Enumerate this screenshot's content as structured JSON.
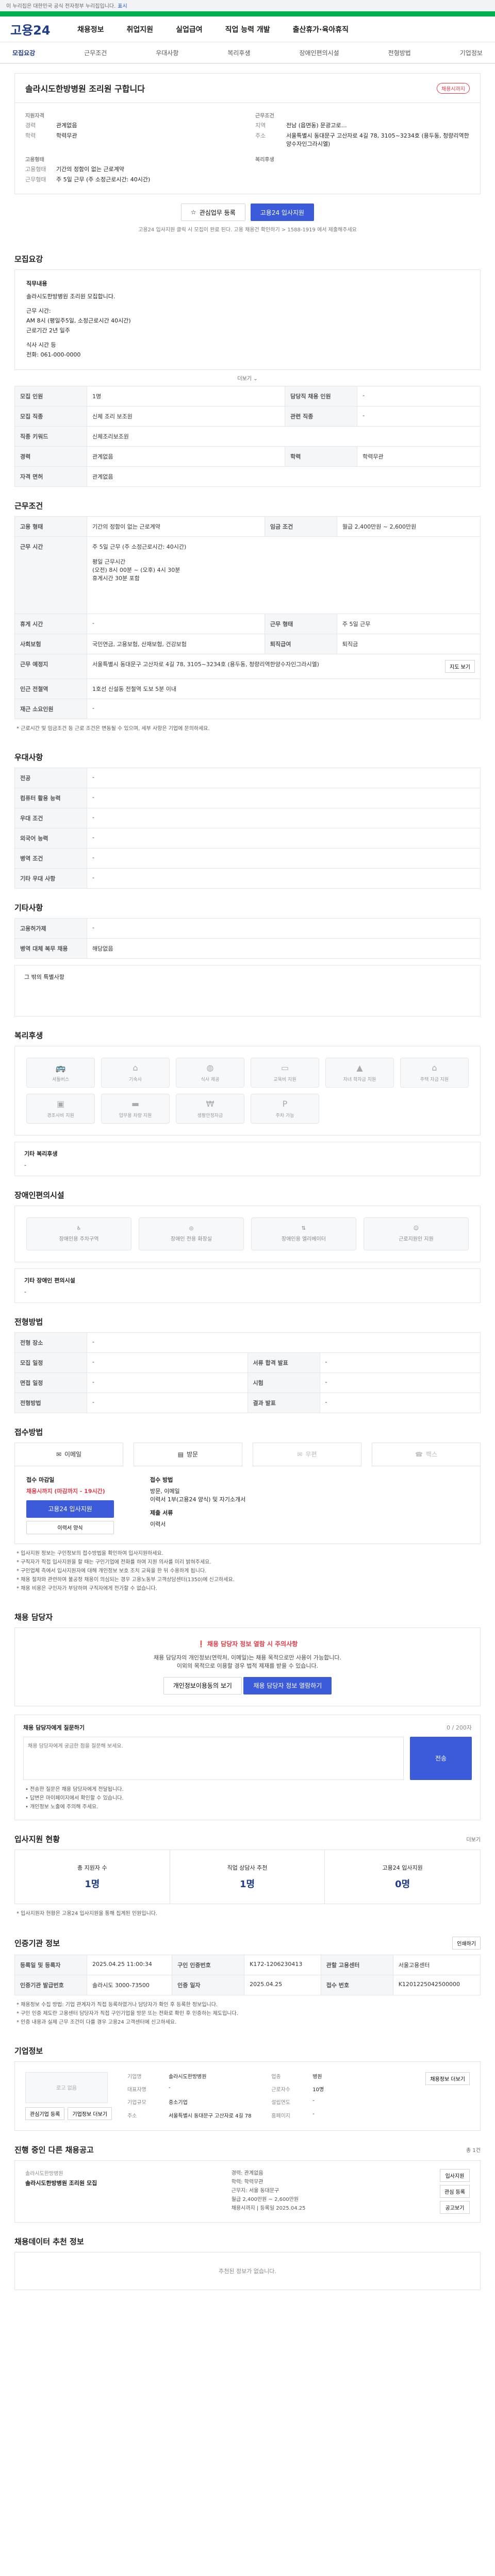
{
  "topbar": {
    "text": "이 누리집은 대한민국 공식 전자정부 누리집입니다.",
    "link": "표시"
  },
  "header": {
    "logo": "고용24",
    "gnb": [
      "채용정보",
      "취업지원",
      "실업급여",
      "직업 능력 개발",
      "출산휴가·육아휴직"
    ]
  },
  "tabs": [
    "모집요강",
    "근무조건",
    "우대사항",
    "복리후생",
    "장애인편의시설",
    "전형방법",
    "기업정보"
  ],
  "job": {
    "title": "솔라시도한방병원 조리원 구합니다",
    "badge": "채용시까지",
    "summary": {
      "qual_label": "지원자격",
      "career_k": "경력",
      "career_v": "관계없음",
      "edu_k": "학력",
      "edu_v": "학력무관",
      "cond_label": "근무조건",
      "region_k": "지역",
      "region_v": "전남 (읍면동) 문광고로…",
      "address_k": "주소",
      "address_v": "서울특별시 동대문구 고산자로 4길 78, 3105~3234호 (용두동, 청량리역한양수자인그라시엘)",
      "form_label": "고용형태",
      "form_k": "고용형태",
      "form_v": "기간의 정함이 없는 근로계약",
      "hours_k": "근무형태",
      "hours_v": "주 5일 근무 (주 소정근로시간: 40시간)",
      "welfare_label": "복리후생"
    },
    "btn_interest": "관심업무 등록",
    "btn_apply": "고용24 입사지원",
    "apply_note": "고용24 입사지원 클릭 시 모집이 완료 된다. 고용 채용건 확인하기 > 1588-1919 에서 제출해주세요"
  },
  "recruit": {
    "title": "모집요강",
    "job_desc_title": "직무내용",
    "job_desc": [
      "솔라시도한방병원 조리원 모집합니다.",
      "",
      "근무 시간:",
      "AM 8시 (평일주5일, 소정근로시간 40시간)",
      "근로기간 2년 일주",
      "",
      "식사 시간 등",
      "전화: 061-000-0000"
    ],
    "fold": "더보기",
    "rows": [
      [
        "모집 인원",
        "1명",
        "담당직 채용 인원",
        "-"
      ],
      [
        "모집 직종",
        "신체 조리 보조원",
        "관련 직종",
        "-"
      ],
      [
        "직종 키워드",
        "신체조리보조원",
        null,
        null
      ],
      [
        "경력",
        "관계없음",
        "학력",
        "학력무관"
      ],
      [
        "자격 면허",
        "관계없음",
        null,
        null
      ]
    ]
  },
  "work": {
    "title": "근무조건",
    "rows": [
      [
        "고용 형태",
        "기간의 정함이 없는 근로계약",
        "임금 조건",
        "월급 2,400만원 ~ 2,600만원"
      ],
      [
        "근무 시간",
        "주 5일 근무 (주 소정근로시간: 40시간)\n\n평일 근무시간\n(오전) 8시 00분 ~ (오후) 4시 30분\n휴게시간 30분 포함",
        "",
        ""
      ],
      [
        "휴게 시간",
        "-",
        "근무 형태",
        "주 5일 근무"
      ],
      [
        "사회보험",
        "국민연금, 고용보험, 산재보험, 건강보험",
        "퇴직급여",
        "퇴직금"
      ],
      [
        "근무 예정지",
        "서울특별시 동대문구 고산자로 4길 78, 3105~3234호 (용두동, 청량리역한양수자인그라시엘)",
        "",
        ""
      ],
      [
        "인근 전철역",
        "1호선 신설동 전철역 도보 5분 이내",
        "",
        ""
      ],
      [
        "재근 소요인원",
        "-",
        "",
        ""
      ]
    ],
    "note": "* 근로시간 및 임금조건 등 근로 조건은 변동될 수 있으며, 세부 사항은 기업에 문의하세요.",
    "map_btn": "지도 보기"
  },
  "prefer": {
    "title": "우대사항",
    "rows": [
      [
        "전공",
        "-"
      ],
      [
        "컴퓨터 활용 능력",
        "-"
      ],
      [
        "우대 조건",
        "-"
      ],
      [
        "외국어 능력",
        "-"
      ],
      [
        "병역 조건",
        "-"
      ],
      [
        "기타 우대 사항",
        "-"
      ]
    ]
  },
  "etc": {
    "title": "기타사항",
    "rows": [
      [
        "고용허가제",
        "-"
      ],
      [
        "병역 대체 복무 채용",
        "해당없음"
      ]
    ],
    "text": "그 밖의 특별사항"
  },
  "welfare": {
    "title": "복리후생",
    "items": [
      [
        "셔틀버스",
        "bus-icon"
      ],
      [
        "기숙사",
        "home-icon"
      ],
      [
        "식사 제공",
        "meal-icon"
      ],
      [
        "교육비 지원",
        "book-icon"
      ],
      [
        "자녀 학자금 지원",
        "grad-icon"
      ],
      [
        "주택 자금 지원",
        "house-icon"
      ],
      [
        "경조사비 지원",
        "gift-icon"
      ],
      [
        "업무용 차량 지원",
        "car-icon"
      ],
      [
        "생활안정자금",
        "money-icon"
      ],
      [
        "주차 가능",
        "parking-icon"
      ]
    ],
    "other_title": "기타 복리후생",
    "other_text": "-"
  },
  "facility": {
    "title": "장애인편의시설",
    "items": [
      [
        "장애인용 주차구역",
        "wheelchair-icon"
      ],
      [
        "장애인 전용 화장실",
        "restroom-icon"
      ],
      [
        "장애인용 엘리베이터",
        "elevator-icon"
      ],
      [
        "근로지원인 지원",
        "support-icon"
      ]
    ],
    "other_title": "기타 장애인 편의시설",
    "other_text": "-"
  },
  "process": {
    "title": "전형방법",
    "rows": [
      [
        "전형 장소",
        "-",
        null,
        null
      ],
      [
        "모집 일정",
        "-",
        "서류 합격 발표",
        "-"
      ],
      [
        "면접 일정",
        "-",
        "시험",
        "-"
      ],
      [
        "전형방법",
        "-",
        "결과 발표",
        "-"
      ]
    ]
  },
  "apply": {
    "title": "접수방법",
    "btn_email": "이메일",
    "btn_visit": "방문",
    "btn_post": "우편",
    "btn_fax": "팩스",
    "deadline_label": "접수 마감일",
    "deadline": "채용시까지 (마감까지 - 19시간)",
    "apply_btn": "고용24 입사지원",
    "form_btn": "이력서 양식",
    "method_label": "접수 방법",
    "method": "방문, 이메일",
    "docs": "이력서 1부(고용24 양식) 및 자기소개서",
    "docs_label": "제출 서류",
    "docs_v": "이력서"
  },
  "bullets": [
    "* 입사지원 정보는 구인정보의 접수방법을 확인하여 입사지원하세요.",
    "* 구직자가 직접 입사지원을 할 때는 구인기업에 전화를 하여 지원 의사를 미리 밝혀주세요.",
    "* 구인업체 측에서 입사지원자에 대해 개인정보 보호 조치 교육을 한 뒤 수용하게 됩니다.",
    "* 채용 절차와 관련하여 불공정 채용이 의심되는 경우 고용노동부 고객상담센터(1350)에 신고하세요.",
    "* 채용 비용은 구인자가 부담하며 구직자에게 전가할 수 없습니다."
  ],
  "contact": {
    "title": "채용 담당자",
    "warn": "채용 담당자 정보 열람 시 주의사항",
    "desc1": "채용 담당자의 개인정보(연락처, 이메일)는 채용 목적으로만 사용이 가능합니다.",
    "desc2": "이외의 목적으로 이용할 경우 법적 제재를 받을 수 있습니다.",
    "btn_agree": "개인정보이용동의 보기",
    "btn_view": "채용 담당자 정보 열람하기",
    "q_title": "채용 담당자에게 질문하기",
    "q_count": "0 / 200자",
    "q_placeholder": "채용 담당자에게 궁금한 점을 질문해 보세요.",
    "q_send": "전송",
    "q_notes": [
      "• 전송한 질문은 채용 담당자에게 전달됩니다.",
      "• 답변은 마이페이지에서 확인할 수 있습니다.",
      "• 개인정보 노출에 주의해 주세요."
    ]
  },
  "status": {
    "title": "입사지원 현황",
    "more": "더보기",
    "items": [
      [
        "총 지원자 수",
        "1명"
      ],
      [
        "직업 상담사 추천",
        "1명"
      ],
      [
        "고용24 입사지원",
        "0명"
      ]
    ],
    "note": "* 입사지원자 현황은 고용24 입사지원을 통해 집계된 인원입니다."
  },
  "info": {
    "title": "인증기관 정보",
    "print": "인쇄하기",
    "rows": [
      [
        "등록일 및 등록자",
        "2025.04.25 11:00:34",
        "구인 인증번호",
        "K172-1206230413",
        "관할 고용센터",
        "서울고용센터"
      ],
      [
        "인증기관 발급번호",
        "솔라시도 3000-73500",
        "인증 일자",
        "2025.04.25",
        "접수 번호",
        "K1201225042500000"
      ]
    ],
    "notes": [
      "* 채용정보 수집 방법: 기업 관계자가 직접 등록하였거나 담당자가 확인 후 등록한 정보입니다.",
      "* 구인 인증 제도란 고용센터 담당자가 직접 구인기업을 방문 또는 전화로 확인 후 인증하는 제도입니다.",
      "* 인증 내용과 실제 근무 조건이 다를 경우 고용24 고객센터에 신고하세요."
    ]
  },
  "corp": {
    "title": "기업정보",
    "logo": "로고 없음",
    "btn1": "관심기업 등록",
    "btn2": "기업정보 더보기",
    "fields": [
      [
        "기업명",
        "솔라시도한방병원",
        "업종",
        "병원"
      ],
      [
        "대표자명",
        "-",
        "근로자수",
        "10명"
      ],
      [
        "기업규모",
        "중소기업",
        "설립연도",
        "-"
      ],
      [
        "주소",
        "서울특별시 동대문구 고산자로 4길 78",
        "홈페이지",
        "-"
      ]
    ],
    "more": "채용정보 더보기"
  },
  "other": {
    "title": "진행 중인 다른 채용공고",
    "sub": "솔라시도한방병원",
    "count": "총 1건",
    "item_title": "솔라시도한방병원 조리원 모집",
    "item_meta": [
      "경력: 관계없음",
      "학력: 학력무관",
      "근무지: 서울 동대문구",
      "월급 2,400만원 ~ 2,600만원",
      "채용시까지 | 등록일 2025.04.25"
    ],
    "btns": [
      "입사지원",
      "관심 등록",
      "공고보기"
    ]
  },
  "recommend": {
    "title": "채용데이터 추천 정보",
    "empty": "추천된 정보가 없습니다."
  }
}
